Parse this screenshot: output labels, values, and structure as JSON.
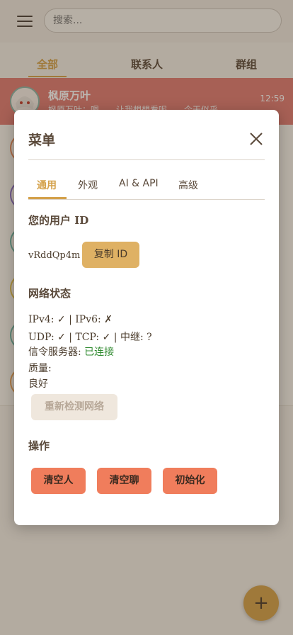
{
  "app": {
    "search_placeholder": "搜索...",
    "tabs": [
      {
        "label": "全部"
      },
      {
        "label": "联系人"
      },
      {
        "label": "群组"
      }
    ],
    "chat": {
      "name": "枫原万叶",
      "preview": "枫原万叶：嗯……让我想想看呢……今天似乎……",
      "time": "12:59"
    },
    "fab_label": "+"
  },
  "modal": {
    "title": "菜单",
    "tabs": [
      {
        "label": "通用"
      },
      {
        "label": "外观"
      },
      {
        "label": "AI & API"
      },
      {
        "label": "高级"
      }
    ],
    "user_id_section": {
      "title": "您的用户 ID",
      "user_id": "vRddQp4m",
      "copy_button": "复制 ID"
    },
    "network_section": {
      "title": "网络状态",
      "line1": "IPv4: ✓ | IPv6: ✗",
      "line2": "UDP: ✓ | TCP: ✓ | 中继: ?",
      "signal_label": "信令服务器: ",
      "signal_value": "已连接",
      "quality_label": "质量:",
      "quality_value": "良好",
      "recheck_button": "重新检测网络"
    },
    "actions_section": {
      "title": "操作",
      "buttons": [
        {
          "label": "清空人"
        },
        {
          "label": "清空聊"
        },
        {
          "label": "初始化"
        }
      ]
    }
  },
  "colors": {
    "accent": "#d4a14a",
    "highlight_row": "#e07b74",
    "danger": "#f07d5c",
    "connected": "#2f8a2f"
  }
}
